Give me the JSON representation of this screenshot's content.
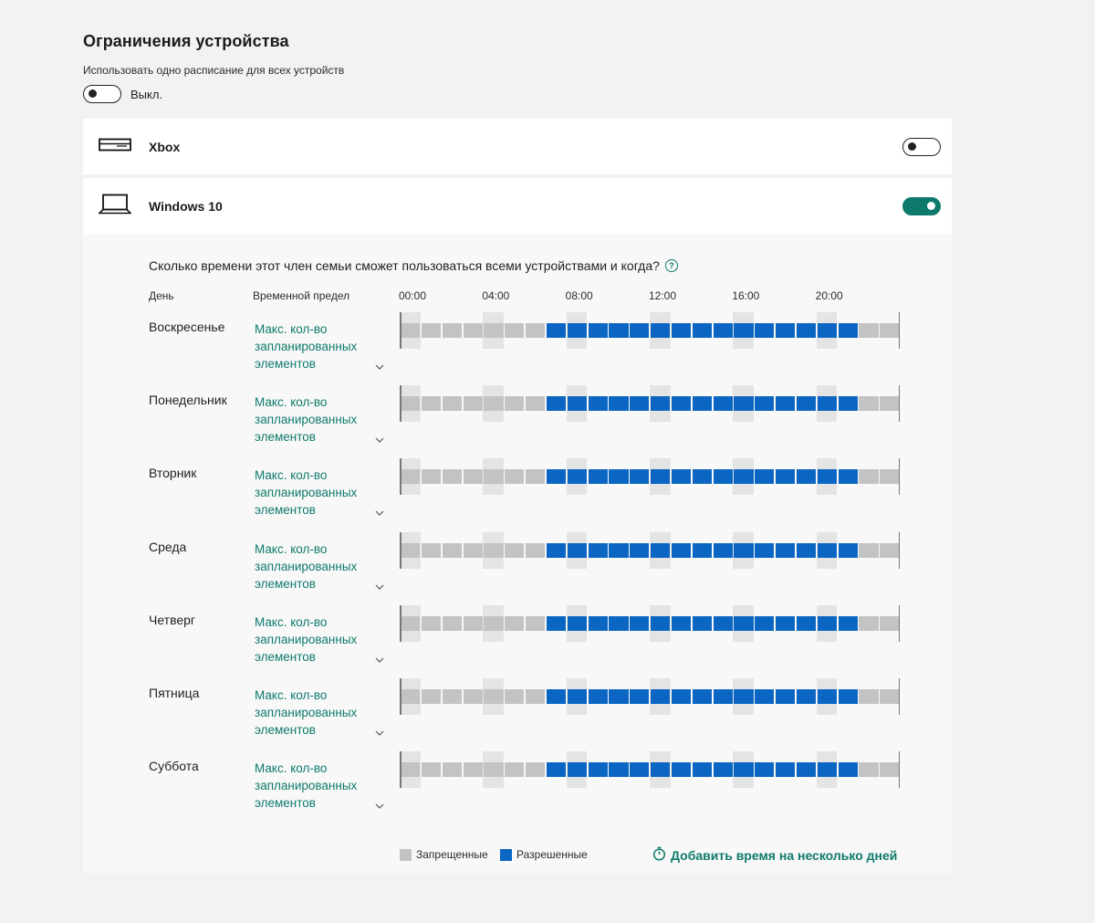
{
  "page": {
    "title": "Ограничения устройства",
    "same_schedule_label": "Использовать одно расписание для всех устройств",
    "same_schedule_state": "Выкл."
  },
  "devices": [
    {
      "name": "Xbox",
      "icon": "xbox-console-icon",
      "enabled": false
    },
    {
      "name": "Windows 10",
      "icon": "laptop-icon",
      "enabled": true
    }
  ],
  "schedule": {
    "question": "Сколько времени этот член семьи сможет пользоваться всеми устройствами и когда?",
    "col_day": "День",
    "col_limit": "Временной предел",
    "hour_labels": [
      "00:00",
      "04:00",
      "08:00",
      "12:00",
      "16:00",
      "20:00"
    ],
    "days": [
      {
        "name": "Воскресенье",
        "limit": "Макс. кол-во запланированных элементов",
        "allowed_from": "07:00",
        "allowed_to": "22:00"
      },
      {
        "name": "Понедельник",
        "limit": "Макс. кол-во запланированных элементов",
        "allowed_from": "07:00",
        "allowed_to": "22:00"
      },
      {
        "name": "Вторник",
        "limit": "Макс. кол-во запланированных элементов",
        "allowed_from": "07:00",
        "allowed_to": "22:00"
      },
      {
        "name": "Среда",
        "limit": "Макс. кол-во запланированных элементов",
        "allowed_from": "07:00",
        "allowed_to": "22:00"
      },
      {
        "name": "Четверг",
        "limit": "Макс. кол-во запланированных элементов",
        "allowed_from": "07:00",
        "allowed_to": "22:00"
      },
      {
        "name": "Пятница",
        "limit": "Макс. кол-во запланированных элементов",
        "allowed_from": "07:00",
        "allowed_to": "22:00"
      },
      {
        "name": "Суббота",
        "limit": "Макс. кол-во запланированных элементов",
        "allowed_from": "07:00",
        "allowed_to": "22:00"
      }
    ]
  },
  "legend": {
    "blocked": "Запрещенные",
    "allowed": "Разрешенные"
  },
  "add_time_label": "Добавить время на несколько дней",
  "colors": {
    "accent": "#0e7a6c",
    "allowed": "#0a66c2",
    "blocked": "#c3c3c3"
  }
}
